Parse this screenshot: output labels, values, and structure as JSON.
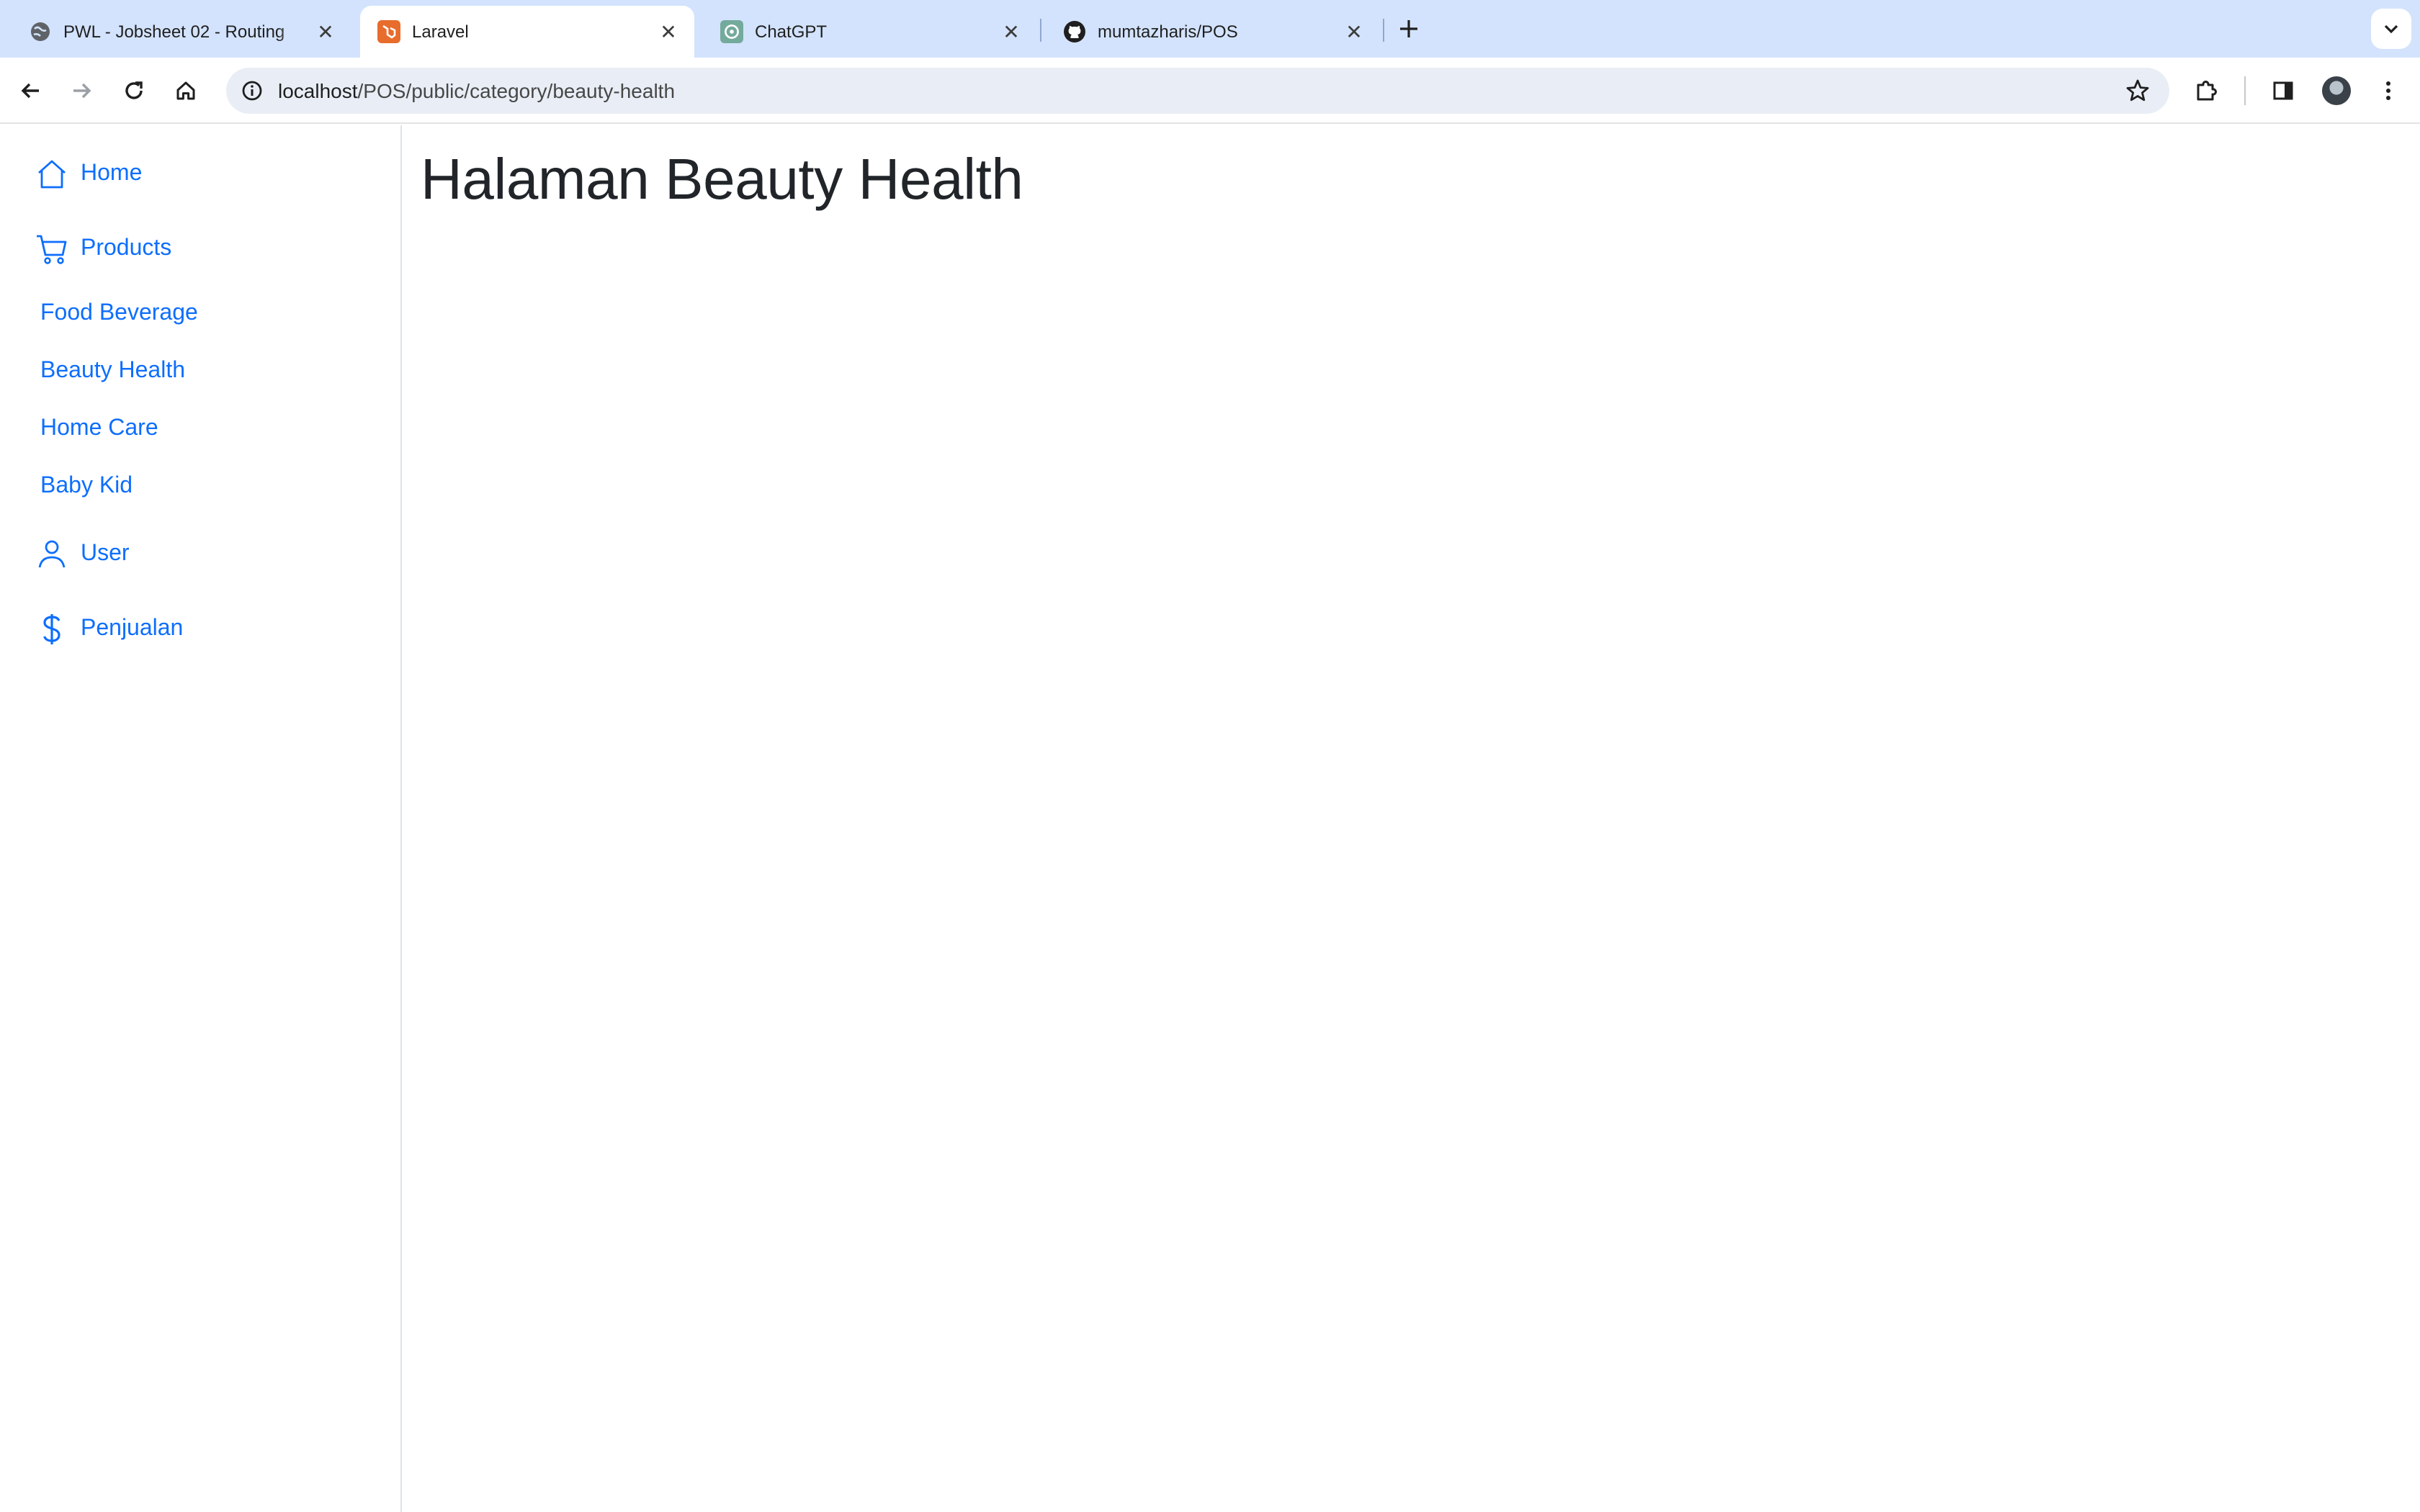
{
  "browser": {
    "tabs": [
      {
        "title": "PWL - Jobsheet 02 - Routing",
        "favicon": "globe-icon",
        "active": false
      },
      {
        "title": "Laravel",
        "favicon": "laravel-icon",
        "active": true
      },
      {
        "title": "ChatGPT",
        "favicon": "chatgpt-icon",
        "active": false
      },
      {
        "title": "mumtazharis/POS",
        "favicon": "github-icon",
        "active": false
      }
    ],
    "url_host": "localhost",
    "url_path": "/POS/public/category/beauty-health"
  },
  "sidebar": {
    "home": "Home",
    "products": "Products",
    "categories": [
      "Food Beverage",
      "Beauty Health",
      "Home Care",
      "Baby Kid"
    ],
    "user": "User",
    "penjualan": "Penjualan"
  },
  "main": {
    "title": "Halaman Beauty Health"
  },
  "colors": {
    "link": "#0d6efd",
    "tabstrip": "#d3e3fd",
    "omnibox": "#e9eef6"
  }
}
